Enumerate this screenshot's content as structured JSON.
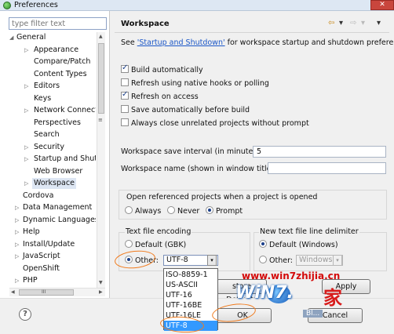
{
  "window": {
    "title": "Preferences",
    "close_glyph": "✕"
  },
  "filter": {
    "placeholder": "type filter text"
  },
  "tree": {
    "items": [
      {
        "label": "General",
        "expanded": true
      },
      {
        "label": "Appearance",
        "has_children": true
      },
      {
        "label": "Compare/Patch"
      },
      {
        "label": "Content Types"
      },
      {
        "label": "Editors",
        "has_children": true
      },
      {
        "label": "Keys"
      },
      {
        "label": "Network Connecti",
        "has_children": true
      },
      {
        "label": "Perspectives"
      },
      {
        "label": "Search"
      },
      {
        "label": "Security",
        "has_children": true
      },
      {
        "label": "Startup and Shutd",
        "has_children": true
      },
      {
        "label": "Web Browser"
      },
      {
        "label": "Workspace",
        "has_children": true,
        "selected": true
      },
      {
        "label": "Cordova"
      },
      {
        "label": "Data Management",
        "has_children": true
      },
      {
        "label": "Dynamic Languages",
        "has_children": true
      },
      {
        "label": "Help",
        "has_children": true
      },
      {
        "label": "Install/Update",
        "has_children": true
      },
      {
        "label": "JavaScript",
        "has_children": true
      },
      {
        "label": "OpenShift"
      },
      {
        "label": "PHP",
        "has_children": true
      }
    ],
    "arrows": {
      "expanded": "◢",
      "collapsed": "▷"
    },
    "scroll": {
      "up": "▲",
      "down": "▼",
      "left": "◀",
      "right": "▶",
      "thumb_grip": "≡",
      "hthumb_grip": "III"
    }
  },
  "page": {
    "title": "Workspace",
    "nav": {
      "back": "⇦",
      "back_menu": "▾",
      "forward": "⇨",
      "forward_menu": "▾",
      "view_menu": "▾"
    },
    "intro_prefix": "See ",
    "intro_link": "'Startup and Shutdown'",
    "intro_suffix": " for workspace startup and shutdown preferences.",
    "checkboxes": [
      {
        "label": "Build automatically",
        "checked": true
      },
      {
        "label": "Refresh using native hooks or polling",
        "checked": false
      },
      {
        "label": "Refresh on access",
        "checked": true
      },
      {
        "label": "Save automatically before build",
        "checked": false
      },
      {
        "label": "Always close unrelated projects without prompt",
        "checked": false
      }
    ],
    "save_interval_label": "Workspace save interval (in minutes):",
    "save_interval_value": "5",
    "workspace_name_label": "Workspace name (shown in window title):",
    "workspace_name_value": "",
    "open_projects": {
      "label": "Open referenced projects when a project is opened",
      "options": [
        "Always",
        "Never",
        "Prompt"
      ],
      "selected": "Prompt"
    },
    "encoding": {
      "label": "Text file encoding",
      "default_option": "Default (GBK)",
      "other_option": "Other:",
      "selected": "Other",
      "value": "UTF-8",
      "dropdown_options": [
        "ISO-8859-1",
        "US-ASCII",
        "UTF-16",
        "UTF-16BE",
        "UTF-16LE",
        "UTF-8"
      ],
      "dropdown_selected": "UTF-8"
    },
    "line_delimiter": {
      "label": "New text file line delimiter",
      "default_option": "Default (Windows)",
      "other_option": "Other:",
      "selected": "Default",
      "other_value": "Windows"
    }
  },
  "buttons": {
    "restore_defaults": "store Defaults",
    "apply": "Apply",
    "ok": "OK",
    "cancel": "Cancel",
    "help": "?"
  },
  "watermark": {
    "url": "www.win7zhijia.cn",
    "logo": "WiN7.",
    "kanji": "家",
    "tag": "Bl..."
  },
  "colors": {
    "accent": "#3399ff",
    "link": "#1a56c7",
    "annotation": "#f07a1c",
    "watermark_red": "#d40a0a"
  }
}
